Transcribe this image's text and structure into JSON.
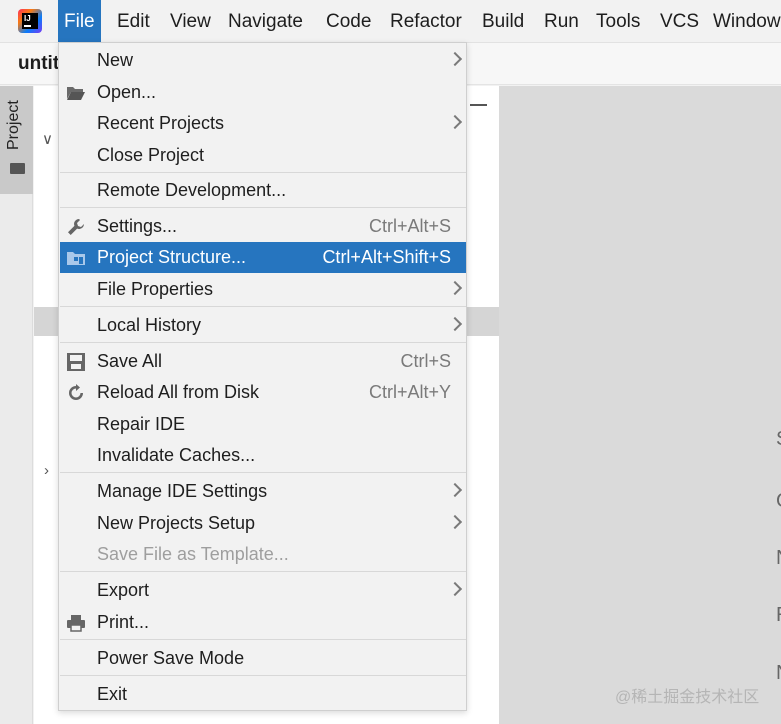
{
  "menubar": {
    "items": [
      {
        "label": "File",
        "active": true
      },
      {
        "label": "Edit"
      },
      {
        "label": "View"
      },
      {
        "label": "Navigate"
      },
      {
        "label": "Code"
      },
      {
        "label": "Refactor"
      },
      {
        "label": "Build"
      },
      {
        "label": "Run"
      },
      {
        "label": "Tools"
      },
      {
        "label": "VCS"
      },
      {
        "label": "Window"
      }
    ]
  },
  "project": {
    "name": "untit",
    "tool_window_label": "Project"
  },
  "file_menu": {
    "items": [
      {
        "label": "New",
        "submenu": true
      },
      {
        "label": "Open...",
        "icon": "folder-open-icon"
      },
      {
        "label": "Recent Projects",
        "submenu": true
      },
      {
        "label": "Close Project"
      },
      {
        "label": "Remote Development..."
      },
      {
        "label": "Settings...",
        "shortcut": "Ctrl+Alt+S",
        "icon": "wrench-icon"
      },
      {
        "label": "Project Structure...",
        "shortcut": "Ctrl+Alt+Shift+S",
        "icon": "project-structure-icon",
        "selected": true
      },
      {
        "label": "File Properties",
        "submenu": true
      },
      {
        "label": "Local History",
        "submenu": true
      },
      {
        "label": "Save All",
        "shortcut": "Ctrl+S",
        "icon": "save-icon"
      },
      {
        "label": "Reload All from Disk",
        "shortcut": "Ctrl+Alt+Y",
        "icon": "reload-icon"
      },
      {
        "label": "Repair IDE"
      },
      {
        "label": "Invalidate Caches..."
      },
      {
        "label": "Manage IDE Settings",
        "submenu": true
      },
      {
        "label": "New Projects Setup",
        "submenu": true
      },
      {
        "label": "Save File as Template...",
        "disabled": true
      },
      {
        "label": "Export",
        "submenu": true
      },
      {
        "label": "Print...",
        "icon": "printer-icon"
      },
      {
        "label": "Power Save Mode"
      },
      {
        "label": "Exit"
      }
    ]
  },
  "editor_edge_chars": [
    "S",
    "G",
    "N",
    "R",
    "N"
  ],
  "watermark": "@稀土掘金技术社区",
  "colors": {
    "selection": "#2675bf",
    "menu_bg": "#f2f2f2"
  }
}
